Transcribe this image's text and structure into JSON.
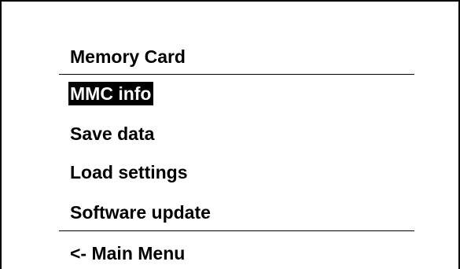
{
  "menu": {
    "title": "Memory Card",
    "items": [
      {
        "label": "MMC info",
        "selected": true
      },
      {
        "label": "Save data",
        "selected": false
      },
      {
        "label": "Load settings",
        "selected": false
      },
      {
        "label": "Software update",
        "selected": false
      }
    ],
    "back_label": "<- Main Menu"
  }
}
